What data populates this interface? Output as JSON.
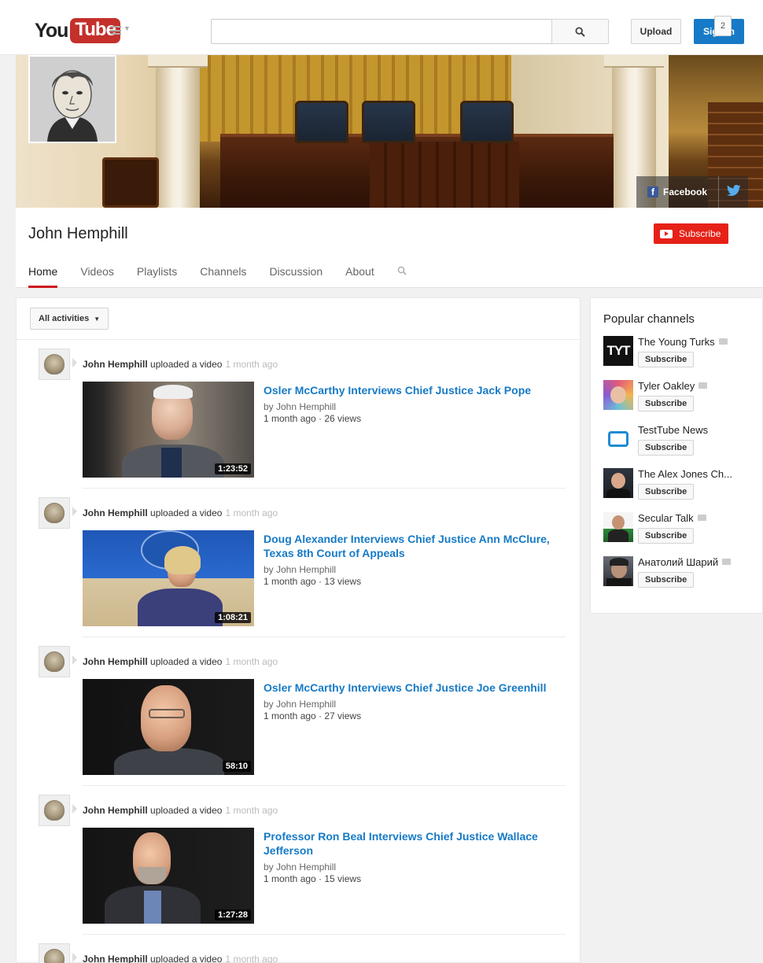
{
  "masthead": {
    "logo_you": "You",
    "logo_tube": "Tube",
    "search_placeholder": "",
    "upload_label": "Upload",
    "signin_label": "Sign in"
  },
  "banner": {
    "facebook_label": "Facebook"
  },
  "channel": {
    "title": "John Hemphill",
    "subscribe_label": "Subscribe",
    "subscriber_count": "2",
    "tabs": [
      {
        "label": "Home",
        "active": true
      },
      {
        "label": "Videos",
        "active": false
      },
      {
        "label": "Playlists",
        "active": false
      },
      {
        "label": "Channels",
        "active": false
      },
      {
        "label": "Discussion",
        "active": false
      },
      {
        "label": "About",
        "active": false
      }
    ]
  },
  "feed": {
    "filter_label": "All activities",
    "items": [
      {
        "author": "John Hemphill",
        "action": "uploaded a video",
        "ago": "1 month ago",
        "title": "Osler McCarthy Interviews Chief Justice Jack Pope",
        "by": "by John Hemphill",
        "meta": "1 month ago · 26 views",
        "duration": "1:23:52"
      },
      {
        "author": "John Hemphill",
        "action": "uploaded a video",
        "ago": "1 month ago",
        "title": "Doug Alexander Interviews Chief Justice Ann McClure, Texas 8th Court of Appeals",
        "by": "by John Hemphill",
        "meta": "1 month ago · 13 views",
        "duration": "1:08:21"
      },
      {
        "author": "John Hemphill",
        "action": "uploaded a video",
        "ago": "1 month ago",
        "title": "Osler McCarthy Interviews Chief Justice Joe Greenhill",
        "by": "by John Hemphill",
        "meta": "1 month ago · 27 views",
        "duration": "58:10"
      },
      {
        "author": "John Hemphill",
        "action": "uploaded a video",
        "ago": "1 month ago",
        "title": "Professor Ron Beal Interviews Chief Justice Wallace Jefferson",
        "by": "by John Hemphill",
        "meta": "1 month ago · 15 views",
        "duration": "1:27:28"
      },
      {
        "author": "John Hemphill",
        "action": "uploaded a video",
        "ago": "1 month ago"
      }
    ]
  },
  "sidebar": {
    "title": "Popular channels",
    "subscribe_label": "Subscribe",
    "channels": [
      {
        "name": "The Young Turks",
        "avatar_text": "TYT"
      },
      {
        "name": "Tyler Oakley"
      },
      {
        "name": "TestTube News"
      },
      {
        "name": "The Alex Jones Ch..."
      },
      {
        "name": "Secular Talk"
      },
      {
        "name": "Анатолий Шарий"
      }
    ]
  },
  "colors": {
    "brand_red": "#c4302b",
    "subscribe_red": "#e62117",
    "link_blue": "#167ac6",
    "signin_blue": "#167ac6"
  }
}
